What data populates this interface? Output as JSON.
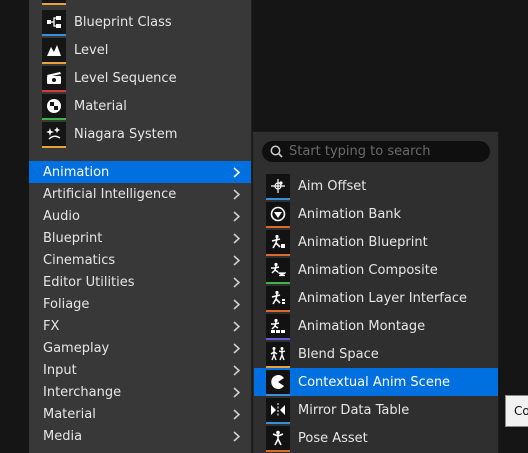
{
  "colors": {
    "selection": "#0070e0",
    "menu_bg": "#383838",
    "submenu_bg": "#2f2f2f",
    "background": "#151515"
  },
  "assets": [
    {
      "label": "",
      "icon": "partial-icon",
      "bar": "#e8a23a"
    },
    {
      "label": "Blueprint Class",
      "icon": "blueprint-class-icon",
      "bar": "#3a8fd8"
    },
    {
      "label": "Level",
      "icon": "level-icon",
      "bar": "#e8a23a"
    },
    {
      "label": "Level Sequence",
      "icon": "level-sequence-icon",
      "bar": "#d23c3c"
    },
    {
      "label": "Material",
      "icon": "material-icon",
      "bar": "#3db34a"
    },
    {
      "label": "Niagara System",
      "icon": "niagara-system-icon",
      "bar": "#e8a23a"
    }
  ],
  "categories": [
    {
      "label": "Animation",
      "selected": true
    },
    {
      "label": "Artificial Intelligence"
    },
    {
      "label": "Audio"
    },
    {
      "label": "Blueprint"
    },
    {
      "label": "Cinematics"
    },
    {
      "label": "Editor Utilities"
    },
    {
      "label": "Foliage"
    },
    {
      "label": "FX"
    },
    {
      "label": "Gameplay"
    },
    {
      "label": "Input"
    },
    {
      "label": "Interchange"
    },
    {
      "label": "Material"
    },
    {
      "label": "Media"
    }
  ],
  "submenu": {
    "search_placeholder": "Start typing to search",
    "items": [
      {
        "label": "Aim Offset",
        "icon": "aim-offset-icon",
        "bar": "#3a8fd8"
      },
      {
        "label": "Animation Bank",
        "icon": "animation-bank-icon",
        "bar": "#d86a2a"
      },
      {
        "label": "Animation Blueprint",
        "icon": "animation-blueprint-icon",
        "bar": "#d86a2a"
      },
      {
        "label": "Animation Composite",
        "icon": "animation-composite-icon",
        "bar": "#3db34a"
      },
      {
        "label": "Animation Layer Interface",
        "icon": "animation-layer-interface-icon",
        "bar": "#d86a2a"
      },
      {
        "label": "Animation Montage",
        "icon": "animation-montage-icon",
        "bar": "#6a5ad8"
      },
      {
        "label": "Blend Space",
        "icon": "blend-space-icon",
        "bar": "#e8a23a"
      },
      {
        "label": "Contextual Anim Scene",
        "icon": "contextual-anim-scene-icon",
        "bar": "#3a8fd8",
        "selected": true
      },
      {
        "label": "Mirror Data Table",
        "icon": "mirror-data-table-icon",
        "bar": "#3a8fd8"
      },
      {
        "label": "Pose Asset",
        "icon": "pose-asset-icon",
        "bar": "#d86a2a"
      }
    ]
  },
  "tooltip": {
    "text": "Co"
  }
}
